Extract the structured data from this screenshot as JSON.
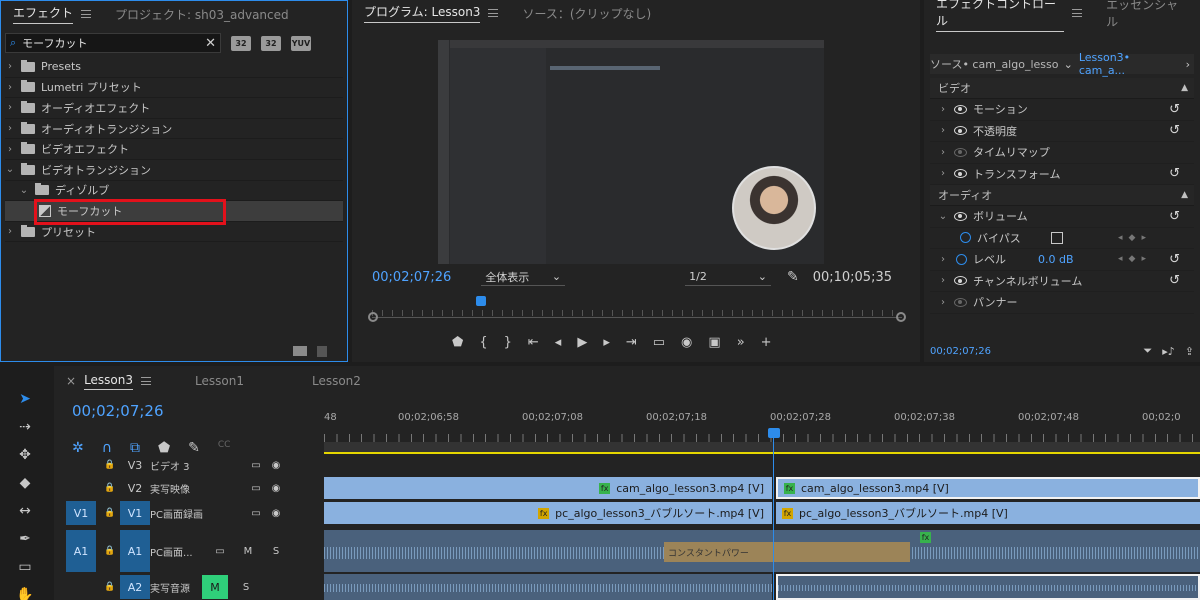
{
  "effects_panel": {
    "tab_effects": "エフェクト",
    "tab_project": "プロジェクト: sh03_advanced",
    "search_value": "モーフカット",
    "filter_buttons": [
      "32",
      "32",
      "YUV"
    ],
    "items": [
      {
        "label": "Presets",
        "expanded": false,
        "level": 0
      },
      {
        "label": "Lumetri プリセット",
        "expanded": false,
        "level": 0
      },
      {
        "label": "オーディオエフェクト",
        "expanded": false,
        "level": 0
      },
      {
        "label": "オーディオトランジション",
        "expanded": false,
        "level": 0
      },
      {
        "label": "ビデオエフェクト",
        "expanded": false,
        "level": 0
      },
      {
        "label": "ビデオトランジション",
        "expanded": true,
        "level": 0
      },
      {
        "label": "ディゾルブ",
        "expanded": true,
        "level": 1
      },
      {
        "label": "モーフカット",
        "level": 2,
        "selected": true
      },
      {
        "label": "プリセット",
        "expanded": false,
        "level": 0
      }
    ]
  },
  "program_monitor": {
    "tab_program": "プログラム: Lesson3",
    "tab_source": "ソース：(クリップなし)",
    "current_timecode": "00;02;07;26",
    "fit_dropdown": "全体表示",
    "resolution_dropdown": "1/2",
    "duration_timecode": "00;10;05;35",
    "transport_icons": [
      "marker-icon",
      "in-point-icon",
      "out-point-icon",
      "go-to-in-icon",
      "step-back-icon",
      "play-icon",
      "step-forward-icon",
      "go-to-out-icon",
      "insert-icon",
      "export-frame-icon",
      "compare-icon",
      "more-icon",
      "add-icon"
    ]
  },
  "effect_controls": {
    "tab_effect_controls": "エフェクトコントロール",
    "tab_essential": "エッセンシャル",
    "source_label": "ソース• cam_algo_lesson...",
    "sequence_label": "Lesson3• cam_a...",
    "video_section": "ビデオ",
    "video_rows": [
      {
        "label": "モーション",
        "eye": true,
        "reset": true
      },
      {
        "label": "不透明度",
        "eye": true,
        "reset": true
      },
      {
        "label": "タイムリマップ",
        "eye": false,
        "reset": false
      },
      {
        "label": "トランスフォーム",
        "eye": true,
        "reset": true
      }
    ],
    "audio_section": "オーディオ",
    "volume_label": "ボリューム",
    "bypass_label": "バイパス",
    "level_label": "レベル",
    "level_value": "0.0 dB",
    "channel_volume_label": "チャンネルボリューム",
    "panner_label": "パンナー",
    "footer_timecode": "00;02;07;26"
  },
  "timeline": {
    "tabs": [
      "Lesson3",
      "Lesson1",
      "Lesson2"
    ],
    "active_tab": "Lesson3",
    "timecode": "00;02;07;26",
    "ruler_labels": [
      "48",
      "00;02;06;58",
      "00;02;07;08",
      "00;02;07;18",
      "00;02;07;28",
      "00;02;07;38",
      "00;02;07;48",
      "00;02;0"
    ],
    "tracks": [
      {
        "id": "V3",
        "name": "ビデオ 3"
      },
      {
        "id": "V2",
        "name": "実写映像"
      },
      {
        "id": "V1",
        "name": "PC画面録画",
        "source": "V1"
      },
      {
        "id": "A1",
        "name": "PC画面...",
        "source": "A1",
        "m": "M",
        "s": "S"
      },
      {
        "id": "A2",
        "name": "実写音源",
        "m": "M",
        "s": "S"
      }
    ],
    "clips": {
      "v2_left": "cam_algo_lesson3.mp4 [V]",
      "v2_right": "cam_algo_lesson3.mp4 [V]",
      "v1_left": "pc_algo_lesson3_バブルソート.mp4 [V]",
      "v1_right": "pc_algo_lesson3_バブルソート.mp4 [V]",
      "transition": "コンスタントパワー"
    }
  },
  "colors": {
    "accent": "#2d8ceb",
    "highlight": "#e3111b",
    "video_clip": "#8ab1df",
    "audio_clip": "#4a617c",
    "solo_green": "#2fcf7a"
  }
}
